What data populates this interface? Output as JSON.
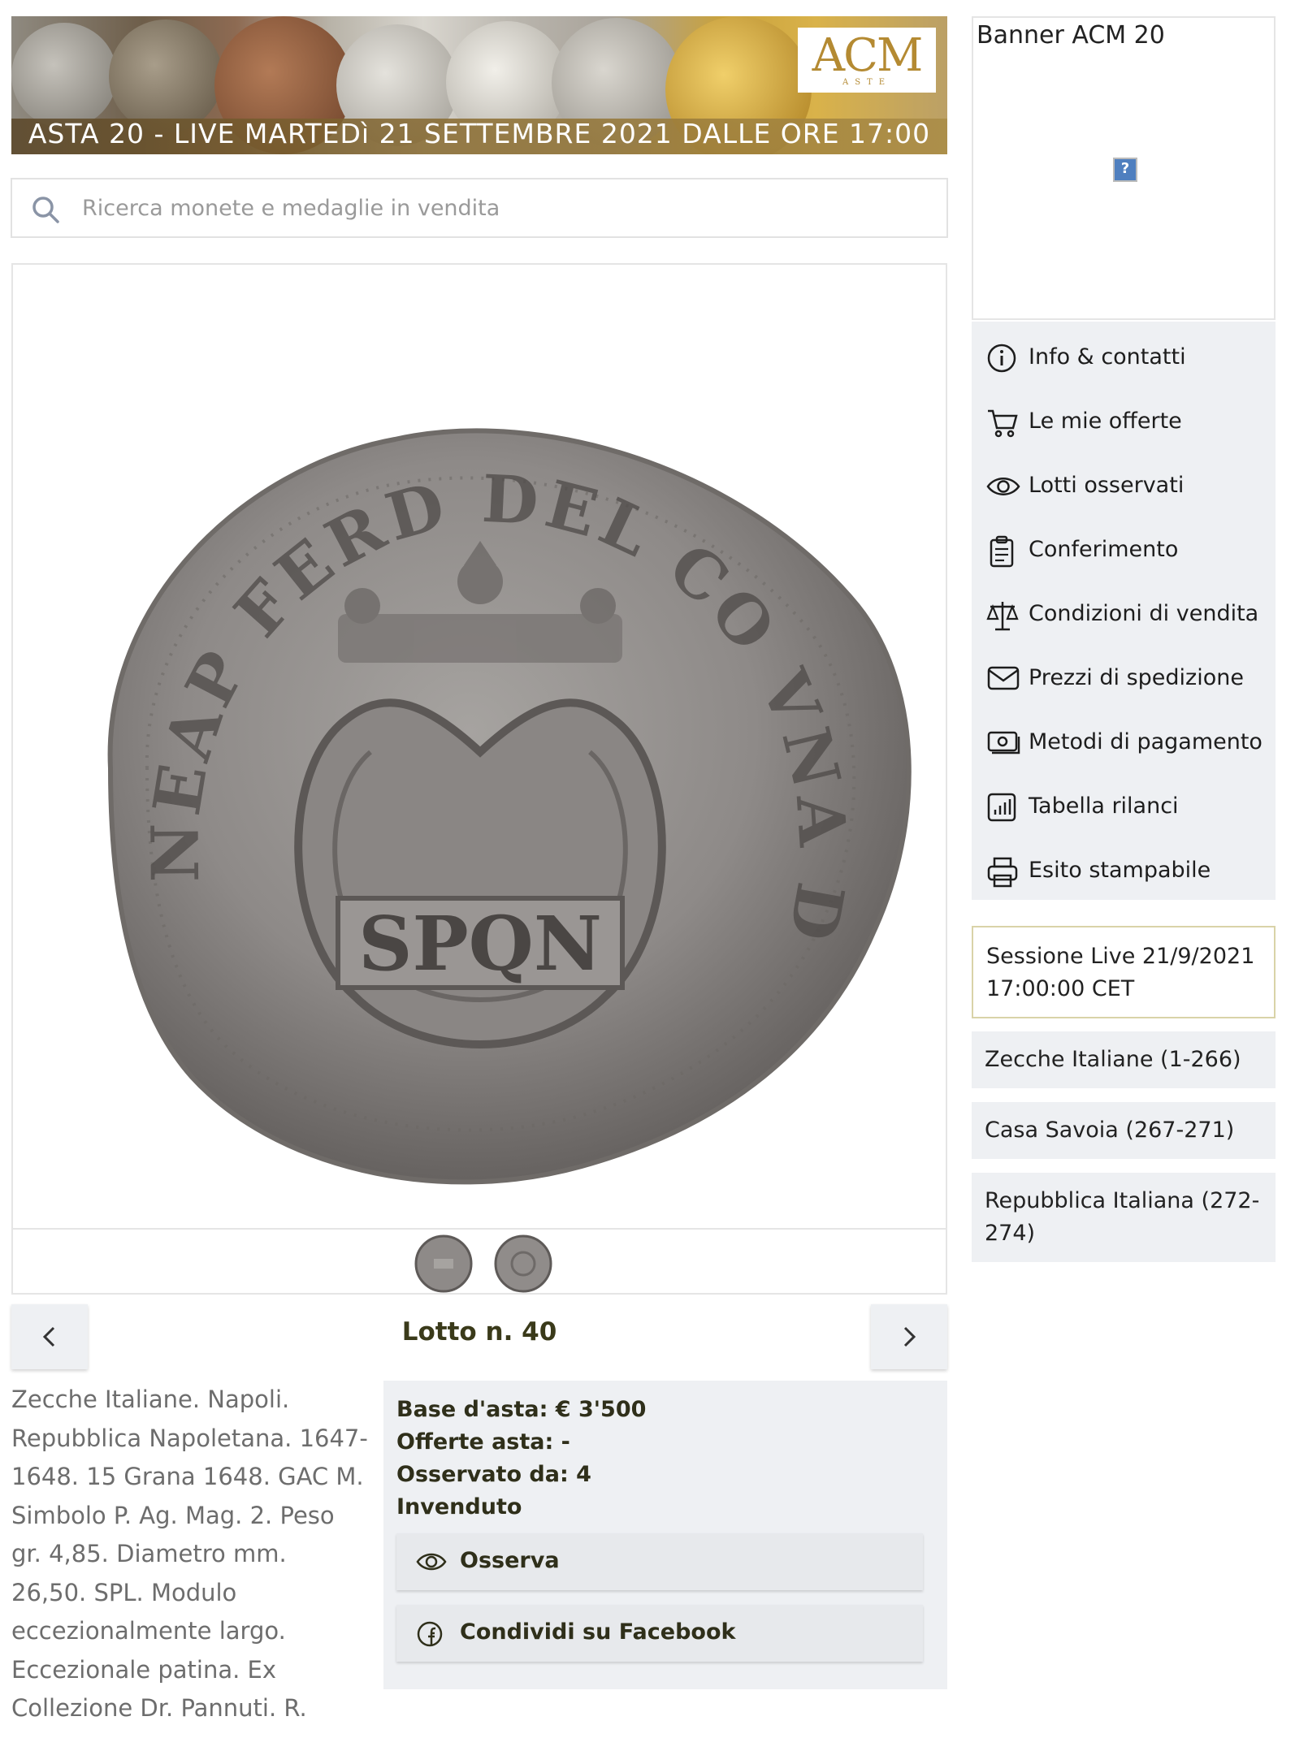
{
  "banner": {
    "text": "ASTA 20 - LIVE MARTEDì 21 SETTEMBRE 2021 DALLE ORE 17:00",
    "logo_text": "ACM",
    "logo_subtext": "ASTE"
  },
  "search": {
    "placeholder": "Ricerca monete e medaglie in vendita"
  },
  "coin": {
    "legend": "NEAP FERD DEL CO VNA DVX REIP",
    "center_text": "SPQN"
  },
  "lot": {
    "title": "Lotto n. 40",
    "description": "Zecche Italiane. Napoli. Repubblica Napoletana. 1647-1648. 15 Grana 1648. GAC M. Simbolo P. Ag. Mag. 2. Peso gr. 4,85. Diametro mm. 26,50. SPL. Modulo eccezionalmente largo. Eccezionale patina. Ex Collezione Dr. Pannuti. R."
  },
  "bid": {
    "base": "Base d'asta: € 3'500",
    "offers": "Offerte asta: -",
    "watched": "Osservato da: 4",
    "status": "Invenduto",
    "watch_label": "Osserva",
    "share_label": "Condividi su Facebook"
  },
  "sidebar": {
    "ad_text": "Banner ACM 20",
    "ad_icon": "?",
    "menu": [
      {
        "label": "Info & contatti",
        "icon": "info-icon"
      },
      {
        "label": "Le mie offerte",
        "icon": "cart-icon"
      },
      {
        "label": "Lotti osservati",
        "icon": "eye-icon"
      },
      {
        "label": "Conferimento",
        "icon": "clipboard-icon"
      },
      {
        "label": "Condizioni di vendita",
        "icon": "scale-icon"
      },
      {
        "label": "Prezzi di spedizione",
        "icon": "envelope-icon"
      },
      {
        "label": "Metodi di pagamento",
        "icon": "money-icon"
      },
      {
        "label": "Tabella rilanci",
        "icon": "chart-icon"
      },
      {
        "label": "Esito stampabile",
        "icon": "printer-icon"
      }
    ],
    "live_session": "Sessione Live 21/9/2021 17:00:00 CET",
    "categories": [
      {
        "label": "Zecche Italiane (1-266)"
      },
      {
        "label": "Casa Savoia (267-271)"
      },
      {
        "label": "Repubblica Italiana (272-274)"
      }
    ]
  },
  "colors": {
    "panel_bg": "#eef0f3",
    "banner_gold": "#b48a32",
    "live_border": "#d9d3a8"
  }
}
